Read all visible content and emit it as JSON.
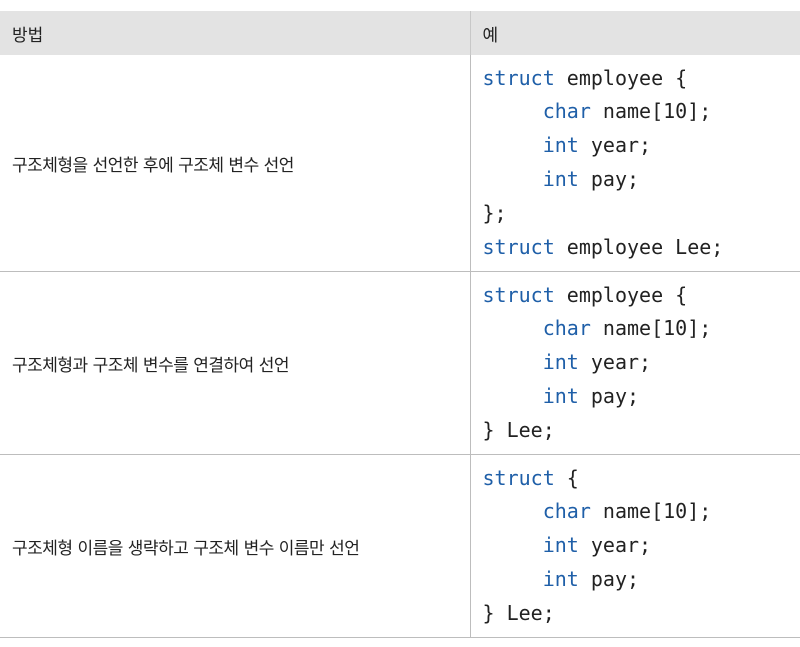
{
  "table": {
    "headers": [
      "방법",
      "예"
    ],
    "rows": [
      {
        "method": "구조체형을 선언한 후에 구조체 변수 선언",
        "code": [
          {
            "kw": "struct",
            "text": " employee {"
          },
          {
            "indent": "     ",
            "kw": "char",
            "text": " name[10];"
          },
          {
            "indent": "     ",
            "kw": "int",
            "text": " year;"
          },
          {
            "indent": "     ",
            "kw": "int",
            "text": " pay;"
          },
          {
            "kw": "",
            "text": "};"
          },
          {
            "kw": "struct",
            "text": " employee Lee;"
          }
        ]
      },
      {
        "method": "구조체형과 구조체 변수를 연결하여 선언",
        "code": [
          {
            "kw": "struct",
            "text": " employee {"
          },
          {
            "indent": "     ",
            "kw": "char",
            "text": " name[10];"
          },
          {
            "indent": "     ",
            "kw": "int",
            "text": " year;"
          },
          {
            "indent": "     ",
            "kw": "int",
            "text": " pay;"
          },
          {
            "kw": "",
            "text": "} Lee;"
          }
        ]
      },
      {
        "method": "구조체형 이름을 생략하고 구조체 변수 이름만 선언",
        "code": [
          {
            "kw": "struct",
            "text": " {"
          },
          {
            "indent": "     ",
            "kw": "char",
            "text": " name[10];"
          },
          {
            "indent": "     ",
            "kw": "int",
            "text": " year;"
          },
          {
            "indent": "     ",
            "kw": "int",
            "text": " pay;"
          },
          {
            "kw": "",
            "text": "} Lee;"
          }
        ]
      }
    ]
  },
  "colors": {
    "keyword": "#1f5fa8",
    "header_bg": "#e3e3e3"
  }
}
